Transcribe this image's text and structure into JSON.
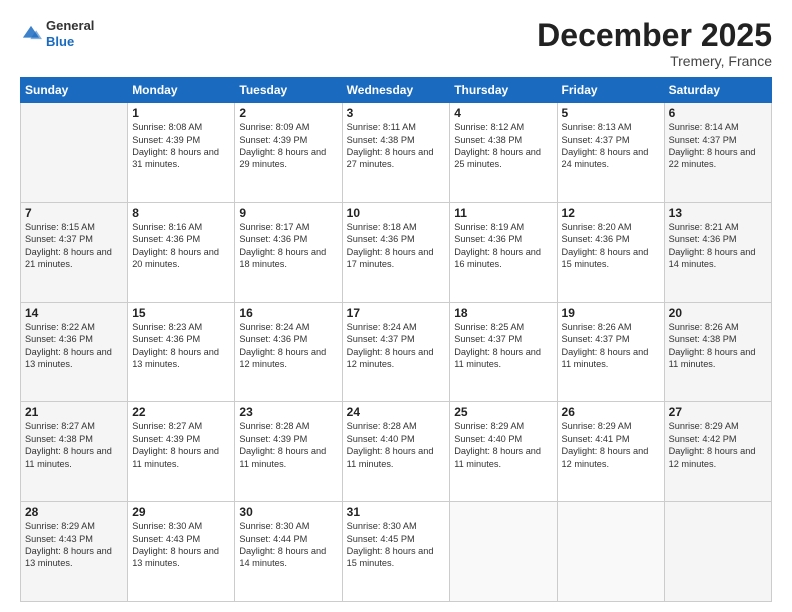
{
  "logo": {
    "general": "General",
    "blue": "Blue"
  },
  "header": {
    "month": "December 2025",
    "location": "Tremery, France"
  },
  "weekdays": [
    "Sunday",
    "Monday",
    "Tuesday",
    "Wednesday",
    "Thursday",
    "Friday",
    "Saturday"
  ],
  "weeks": [
    [
      {
        "day": "",
        "sunrise": "",
        "sunset": "",
        "daylight": ""
      },
      {
        "day": "1",
        "sunrise": "Sunrise: 8:08 AM",
        "sunset": "Sunset: 4:39 PM",
        "daylight": "Daylight: 8 hours and 31 minutes."
      },
      {
        "day": "2",
        "sunrise": "Sunrise: 8:09 AM",
        "sunset": "Sunset: 4:39 PM",
        "daylight": "Daylight: 8 hours and 29 minutes."
      },
      {
        "day": "3",
        "sunrise": "Sunrise: 8:11 AM",
        "sunset": "Sunset: 4:38 PM",
        "daylight": "Daylight: 8 hours and 27 minutes."
      },
      {
        "day": "4",
        "sunrise": "Sunrise: 8:12 AM",
        "sunset": "Sunset: 4:38 PM",
        "daylight": "Daylight: 8 hours and 25 minutes."
      },
      {
        "day": "5",
        "sunrise": "Sunrise: 8:13 AM",
        "sunset": "Sunset: 4:37 PM",
        "daylight": "Daylight: 8 hours and 24 minutes."
      },
      {
        "day": "6",
        "sunrise": "Sunrise: 8:14 AM",
        "sunset": "Sunset: 4:37 PM",
        "daylight": "Daylight: 8 hours and 22 minutes."
      }
    ],
    [
      {
        "day": "7",
        "sunrise": "Sunrise: 8:15 AM",
        "sunset": "Sunset: 4:37 PM",
        "daylight": "Daylight: 8 hours and 21 minutes."
      },
      {
        "day": "8",
        "sunrise": "Sunrise: 8:16 AM",
        "sunset": "Sunset: 4:36 PM",
        "daylight": "Daylight: 8 hours and 20 minutes."
      },
      {
        "day": "9",
        "sunrise": "Sunrise: 8:17 AM",
        "sunset": "Sunset: 4:36 PM",
        "daylight": "Daylight: 8 hours and 18 minutes."
      },
      {
        "day": "10",
        "sunrise": "Sunrise: 8:18 AM",
        "sunset": "Sunset: 4:36 PM",
        "daylight": "Daylight: 8 hours and 17 minutes."
      },
      {
        "day": "11",
        "sunrise": "Sunrise: 8:19 AM",
        "sunset": "Sunset: 4:36 PM",
        "daylight": "Daylight: 8 hours and 16 minutes."
      },
      {
        "day": "12",
        "sunrise": "Sunrise: 8:20 AM",
        "sunset": "Sunset: 4:36 PM",
        "daylight": "Daylight: 8 hours and 15 minutes."
      },
      {
        "day": "13",
        "sunrise": "Sunrise: 8:21 AM",
        "sunset": "Sunset: 4:36 PM",
        "daylight": "Daylight: 8 hours and 14 minutes."
      }
    ],
    [
      {
        "day": "14",
        "sunrise": "Sunrise: 8:22 AM",
        "sunset": "Sunset: 4:36 PM",
        "daylight": "Daylight: 8 hours and 13 minutes."
      },
      {
        "day": "15",
        "sunrise": "Sunrise: 8:23 AM",
        "sunset": "Sunset: 4:36 PM",
        "daylight": "Daylight: 8 hours and 13 minutes."
      },
      {
        "day": "16",
        "sunrise": "Sunrise: 8:24 AM",
        "sunset": "Sunset: 4:36 PM",
        "daylight": "Daylight: 8 hours and 12 minutes."
      },
      {
        "day": "17",
        "sunrise": "Sunrise: 8:24 AM",
        "sunset": "Sunset: 4:37 PM",
        "daylight": "Daylight: 8 hours and 12 minutes."
      },
      {
        "day": "18",
        "sunrise": "Sunrise: 8:25 AM",
        "sunset": "Sunset: 4:37 PM",
        "daylight": "Daylight: 8 hours and 11 minutes."
      },
      {
        "day": "19",
        "sunrise": "Sunrise: 8:26 AM",
        "sunset": "Sunset: 4:37 PM",
        "daylight": "Daylight: 8 hours and 11 minutes."
      },
      {
        "day": "20",
        "sunrise": "Sunrise: 8:26 AM",
        "sunset": "Sunset: 4:38 PM",
        "daylight": "Daylight: 8 hours and 11 minutes."
      }
    ],
    [
      {
        "day": "21",
        "sunrise": "Sunrise: 8:27 AM",
        "sunset": "Sunset: 4:38 PM",
        "daylight": "Daylight: 8 hours and 11 minutes."
      },
      {
        "day": "22",
        "sunrise": "Sunrise: 8:27 AM",
        "sunset": "Sunset: 4:39 PM",
        "daylight": "Daylight: 8 hours and 11 minutes."
      },
      {
        "day": "23",
        "sunrise": "Sunrise: 8:28 AM",
        "sunset": "Sunset: 4:39 PM",
        "daylight": "Daylight: 8 hours and 11 minutes."
      },
      {
        "day": "24",
        "sunrise": "Sunrise: 8:28 AM",
        "sunset": "Sunset: 4:40 PM",
        "daylight": "Daylight: 8 hours and 11 minutes."
      },
      {
        "day": "25",
        "sunrise": "Sunrise: 8:29 AM",
        "sunset": "Sunset: 4:40 PM",
        "daylight": "Daylight: 8 hours and 11 minutes."
      },
      {
        "day": "26",
        "sunrise": "Sunrise: 8:29 AM",
        "sunset": "Sunset: 4:41 PM",
        "daylight": "Daylight: 8 hours and 12 minutes."
      },
      {
        "day": "27",
        "sunrise": "Sunrise: 8:29 AM",
        "sunset": "Sunset: 4:42 PM",
        "daylight": "Daylight: 8 hours and 12 minutes."
      }
    ],
    [
      {
        "day": "28",
        "sunrise": "Sunrise: 8:29 AM",
        "sunset": "Sunset: 4:43 PM",
        "daylight": "Daylight: 8 hours and 13 minutes."
      },
      {
        "day": "29",
        "sunrise": "Sunrise: 8:30 AM",
        "sunset": "Sunset: 4:43 PM",
        "daylight": "Daylight: 8 hours and 13 minutes."
      },
      {
        "day": "30",
        "sunrise": "Sunrise: 8:30 AM",
        "sunset": "Sunset: 4:44 PM",
        "daylight": "Daylight: 8 hours and 14 minutes."
      },
      {
        "day": "31",
        "sunrise": "Sunrise: 8:30 AM",
        "sunset": "Sunset: 4:45 PM",
        "daylight": "Daylight: 8 hours and 15 minutes."
      },
      {
        "day": "",
        "sunrise": "",
        "sunset": "",
        "daylight": ""
      },
      {
        "day": "",
        "sunrise": "",
        "sunset": "",
        "daylight": ""
      },
      {
        "day": "",
        "sunrise": "",
        "sunset": "",
        "daylight": ""
      }
    ]
  ]
}
